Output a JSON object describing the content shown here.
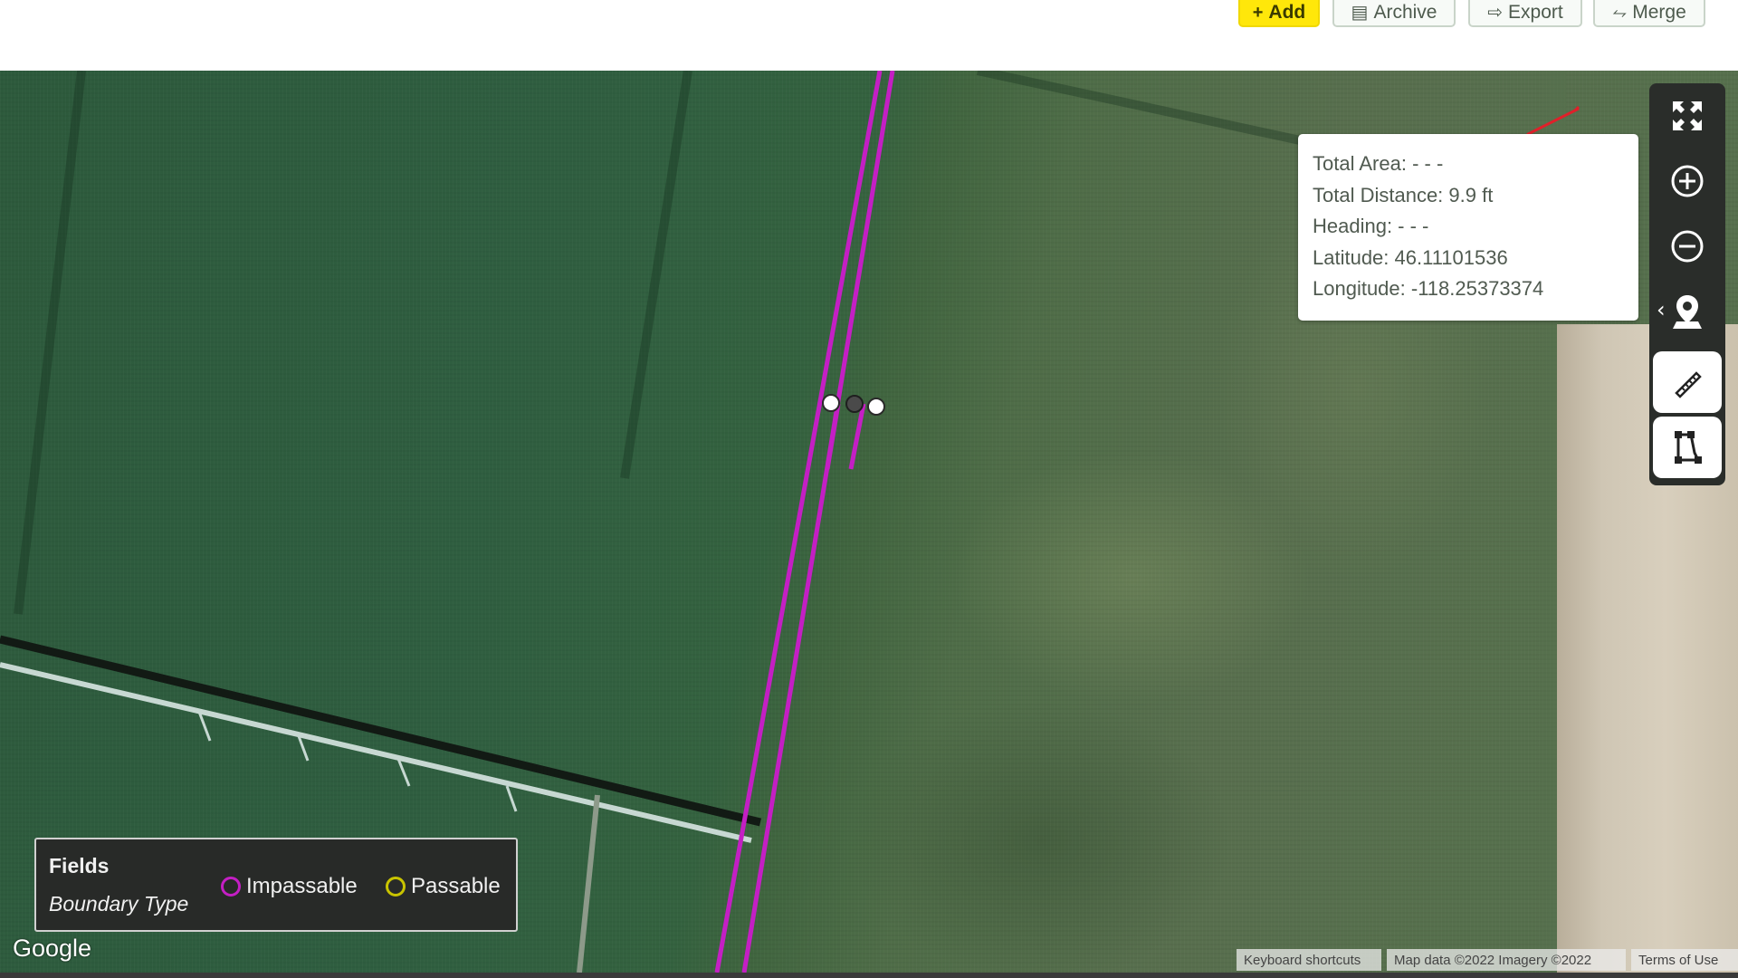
{
  "toolbar": {
    "add_label": "Add",
    "archive_label": "Archive",
    "export_label": "Export",
    "merge_label": "Merge"
  },
  "info_popup": {
    "total_area": "Total Area: - - -",
    "total_distance": "Total Distance: 9.9 ft",
    "heading": "Heading: - - -",
    "latitude": "Latitude: 46.11101536",
    "longitude": "Longitude: -118.25373374"
  },
  "map_controls": {
    "icons": [
      "fullscreen-icon",
      "zoom-in-icon",
      "zoom-out-icon",
      "location-pin-icon",
      "ruler-icon",
      "draw-boundary-icon"
    ]
  },
  "legend": {
    "title": "Fields",
    "subtitle": "Boundary Type",
    "items": [
      {
        "label": "Impassable",
        "color": "#c41fc4"
      },
      {
        "label": "Passable",
        "color": "#c9c400"
      }
    ]
  },
  "map": {
    "logo": "Google",
    "attribution": {
      "keyboard": "Keyboard shortcuts",
      "data": "Map data ©2022 Imagery ©2022",
      "terms": "Terms of Use"
    }
  },
  "colors": {
    "boundary_impassable": "#c41fc4",
    "boundary_passable": "#c9c400",
    "add_button": "#ffe70a",
    "annotation": "#e0202a"
  }
}
